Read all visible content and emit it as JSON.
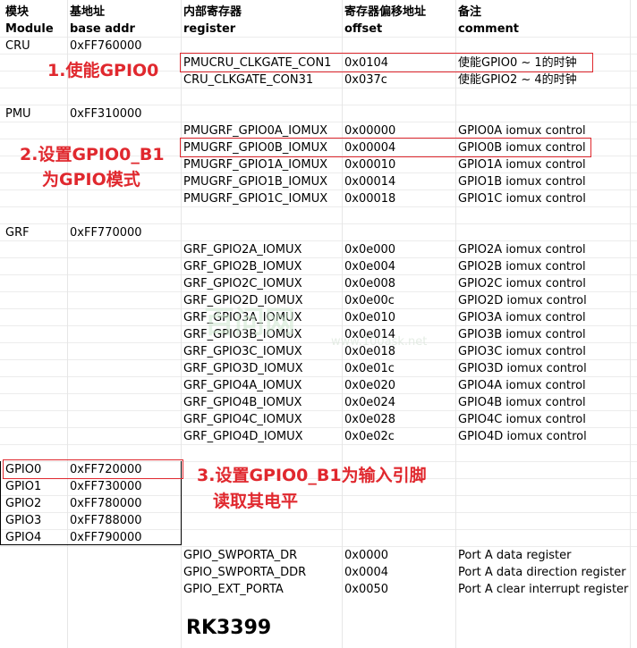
{
  "headers": {
    "module_cn": "模块",
    "module_en": "Module",
    "base_cn": "基地址",
    "base_en": "base addr",
    "reg_cn": "内部寄存器",
    "reg_en": "register",
    "offset_cn": "寄存器偏移地址",
    "offset_en": "offset",
    "comment_cn": "备注",
    "comment_en": "comment"
  },
  "cru": {
    "module": "CRU",
    "base": "0xFF760000",
    "rows": [
      {
        "register": "PMUCRU_CLKGATE_CON1",
        "offset": "0x0104",
        "comment": "使能GPIO0 ~ 1的时钟"
      },
      {
        "register": "CRU_CLKGATE_CON31",
        "offset": "0x037c",
        "comment": "使能GPIO2 ~ 4的时钟"
      }
    ]
  },
  "pmu": {
    "module": "PMU",
    "base": "0xFF310000",
    "rows": [
      {
        "register": "PMUGRF_GPIO0A_IOMUX",
        "offset": "0x00000",
        "comment": "GPIO0A iomux control"
      },
      {
        "register": "PMUGRF_GPIO0B_IOMUX",
        "offset": "0x00004",
        "comment": "GPIO0B iomux control"
      },
      {
        "register": "PMUGRF_GPIO1A_IOMUX",
        "offset": "0x00010",
        "comment": "GPIO1A iomux control"
      },
      {
        "register": "PMUGRF_GPIO1B_IOMUX",
        "offset": "0x00014",
        "comment": "GPIO1B iomux control"
      },
      {
        "register": "PMUGRF_GPIO1C_IOMUX",
        "offset": "0x00018",
        "comment": "GPIO1C iomux control"
      }
    ]
  },
  "grf": {
    "module": "GRF",
    "base": "0xFF770000",
    "rows": [
      {
        "register": "GRF_GPIO2A_IOMUX",
        "offset": "0x0e000",
        "comment": "GPIO2A iomux control"
      },
      {
        "register": "GRF_GPIO2B_IOMUX",
        "offset": "0x0e004",
        "comment": "GPIO2B iomux control"
      },
      {
        "register": "GRF_GPIO2C_IOMUX",
        "offset": "0x0e008",
        "comment": "GPIO2C iomux control"
      },
      {
        "register": "GRF_GPIO2D_IOMUX",
        "offset": "0x0e00c",
        "comment": "GPIO2D iomux control"
      },
      {
        "register": "GRF_GPIO3A_IOMUX",
        "offset": "0x0e010",
        "comment": "GPIO3A iomux control"
      },
      {
        "register": "GRF_GPIO3B_IOMUX",
        "offset": "0x0e014",
        "comment": "GPIO3B iomux control"
      },
      {
        "register": "GRF_GPIO3C_IOMUX",
        "offset": "0x0e018",
        "comment": "GPIO3C iomux control"
      },
      {
        "register": "GRF_GPIO3D_IOMUX",
        "offset": "0x0e01c",
        "comment": "GPIO3D iomux control"
      },
      {
        "register": "GRF_GPIO4A_IOMUX",
        "offset": "0x0e020",
        "comment": "GPIO4A iomux control"
      },
      {
        "register": "GRF_GPIO4B_IOMUX",
        "offset": "0x0e024",
        "comment": "GPIO4B iomux control"
      },
      {
        "register": "GRF_GPIO4C_IOMUX",
        "offset": "0x0e028",
        "comment": "GPIO4C iomux control"
      },
      {
        "register": "GRF_GPIO4D_IOMUX",
        "offset": "0x0e02c",
        "comment": "GPIO4D iomux control"
      }
    ]
  },
  "gpio_modules": [
    {
      "module": "GPIO0",
      "base": "0xFF720000"
    },
    {
      "module": "GPIO1",
      "base": "0xFF730000"
    },
    {
      "module": "GPIO2",
      "base": "0xFF780000"
    },
    {
      "module": "GPIO3",
      "base": "0xFF788000"
    },
    {
      "module": "GPIO4",
      "base": "0xFF790000"
    }
  ],
  "gpio_regs": [
    {
      "register": "GPIO_SWPORTA_DR",
      "offset": "0x0000",
      "comment": "Port A data register"
    },
    {
      "register": "GPIO_SWPORTA_DDR",
      "offset": "0x0004",
      "comment": "Port A data direction register"
    },
    {
      "register": "GPIO_EXT_PORTA",
      "offset": "0x0050",
      "comment": "Port A clear interrupt register"
    }
  ],
  "annotations": {
    "step1": "1.使能GPIO0",
    "step2_line1": "2.设置GPIO0_B1",
    "step2_line2": "为GPIO模式",
    "step3_line1": "3.设置GPIO0_B1为输入引脚",
    "step3_line2": "读取其电平"
  },
  "watermark": {
    "main": "百问网",
    "sub": "www.100ask.net"
  },
  "title": "RK3399",
  "colors": {
    "annotation": "#e0282e"
  }
}
